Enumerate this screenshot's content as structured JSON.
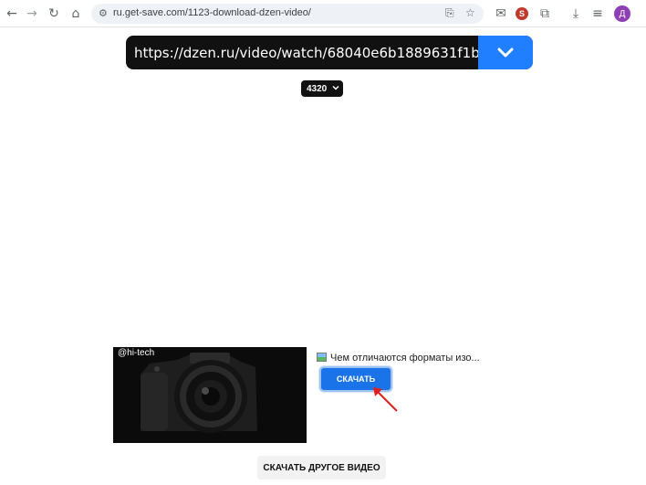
{
  "browser": {
    "url": "ru.get-save.com/1123-download-dzen-video/",
    "avatar_letter": "Д",
    "ext_letter": "S",
    "icons": [
      "back-icon",
      "forward-icon",
      "reload-icon",
      "home-icon",
      "site-info-icon",
      "install-icon",
      "bookmark-star-icon",
      "mail-icon",
      "extension-icon",
      "puzzle-icon",
      "download-icon",
      "reading-list-icon",
      "avatar"
    ]
  },
  "form": {
    "video_url": "https://dzen.ru/video/watch/68040e6b1889631f1b5...",
    "submit_icon": "chevron-down-icon",
    "quality_value": "4320",
    "accent_color": "#1f7fff"
  },
  "result": {
    "thumb_label": "@hi-tech",
    "title": "Чем отличаются форматы изо...",
    "download_label": "СКАЧАТЬ",
    "other_video_label": "СКАЧАТЬ ДРУГОЕ ВИДЕО"
  }
}
